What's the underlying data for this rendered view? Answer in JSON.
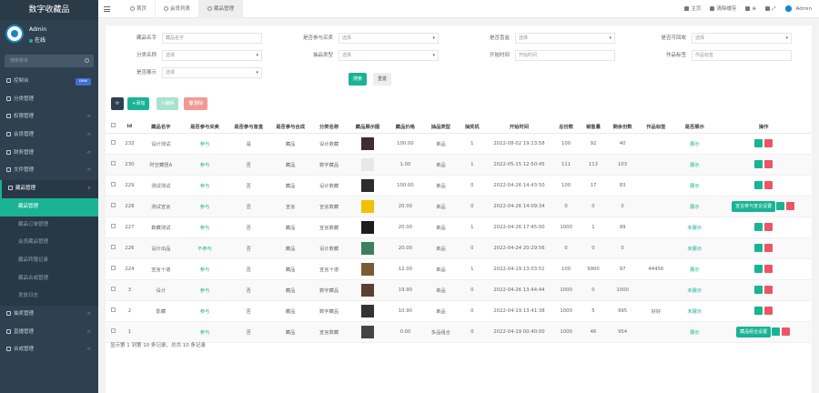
{
  "sidebar": {
    "brand": "数字收藏品",
    "user_name": "Admin",
    "user_status": "在线",
    "search_placeholder": "搜索菜单",
    "menu": [
      {
        "label": "控制台",
        "badge": "new"
      },
      {
        "label": "分类管理"
      },
      {
        "label": "权限管理",
        "chev": "<"
      },
      {
        "label": "会员管理",
        "chev": "<"
      },
      {
        "label": "财务管理",
        "chev": "<"
      },
      {
        "label": "文件管理",
        "chev": "<"
      },
      {
        "label": "藏品管理",
        "chev": "∨",
        "active": true
      }
    ],
    "submenu": [
      {
        "label": "藏品管理",
        "on": true
      },
      {
        "label": "藏品订单管理"
      },
      {
        "label": "会员藏品管理"
      },
      {
        "label": "藏品转赠记录"
      },
      {
        "label": "藏品合成管理"
      },
      {
        "label": "发放日志"
      }
    ],
    "menu2": [
      {
        "label": "抽奖管理",
        "chev": "<"
      },
      {
        "label": "直播管理",
        "chev": "<"
      },
      {
        "label": "合成管理",
        "chev": "<"
      }
    ]
  },
  "topbar": {
    "tabs": [
      "首页",
      "会员列表",
      "藏品管理"
    ],
    "right": [
      "主页",
      "清除缓存",
      "⊕",
      "⤢"
    ],
    "admin": "Admin"
  },
  "filters": {
    "row1": [
      {
        "label": "藏品名字",
        "placeholder": "藏品名字"
      },
      {
        "label": "是否参与买卖",
        "value": "选择",
        "select": true
      },
      {
        "label": "是否盲盒",
        "value": "选择",
        "select": true
      },
      {
        "label": "是否可回收",
        "value": "选择",
        "select": true
      }
    ],
    "row2": [
      {
        "label": "分类名称",
        "value": "选择",
        "select": true
      },
      {
        "label": "抽品类型",
        "value": "选择",
        "select": true
      },
      {
        "label": "开始时间",
        "placeholder": "开始时间"
      },
      {
        "label": "作品标签",
        "placeholder": "作品标签"
      }
    ],
    "row3": [
      {
        "label": "是否展示",
        "value": "选择",
        "select": true
      }
    ],
    "search": "搜索",
    "reset": "重置"
  },
  "toolbar": {
    "refresh": "⟳",
    "add": "+添加",
    "edit": "✎编辑",
    "delete": "🗑删除"
  },
  "table": {
    "headers": [
      "",
      "id",
      "藏品名字",
      "是否参与买卖",
      "是否参与盲盒",
      "是否参与合成",
      "分类名称",
      "藏品展示图",
      "藏品价格",
      "抽品类型",
      "抽奖机",
      "开始时间",
      "总份数",
      "销售量",
      "剩余份数",
      "作品标签",
      "是否展示",
      "操作"
    ],
    "rows": [
      {
        "id": "232",
        "name": "设计测试",
        "trade": "参与",
        "blind": "是",
        "merge": "藏品",
        "cat": "设计数藏",
        "price": "100.00",
        "type": "单品",
        "n": "1",
        "time": "2022-08-02 19:13:58",
        "total": "100",
        "sold": "92",
        "left": "40",
        "tag": "",
        "show": "展示",
        "extra": ""
      },
      {
        "id": "230",
        "name": "时空藏匣A",
        "trade": "参与",
        "blind": "否",
        "merge": "藏品",
        "cat": "数字藏品",
        "price": "1.00",
        "type": "单品",
        "n": "1",
        "time": "2022-05-15 12:50:45",
        "total": "111",
        "sold": "113",
        "left": "103",
        "tag": "",
        "show": "展示",
        "extra": ""
      },
      {
        "id": "229",
        "name": "测试测试",
        "trade": "参与",
        "blind": "否",
        "merge": "藏品",
        "cat": "设计数藏",
        "price": "100.00",
        "type": "单品",
        "n": "0",
        "time": "2022-04-26 14:43:50",
        "total": "100",
        "sold": "17",
        "left": "83",
        "tag": "",
        "show": "展示",
        "extra": ""
      },
      {
        "id": "228",
        "name": "测试宣言",
        "trade": "参与",
        "blind": "否",
        "merge": "宣言",
        "cat": "宣言数藏",
        "price": "20.00",
        "type": "单品",
        "n": "0",
        "time": "2022-04-26 14:09:34",
        "total": "0",
        "sold": "0",
        "left": "0",
        "tag": "",
        "show": "展示",
        "extra": "宣言参与宣言设置"
      },
      {
        "id": "227",
        "name": "数藏测试",
        "trade": "参与",
        "blind": "否",
        "merge": "藏品",
        "cat": "宣言数藏",
        "price": "20.00",
        "type": "单品",
        "n": "1",
        "time": "2022-04-26 17:45:00",
        "total": "1000",
        "sold": "1",
        "left": "99",
        "tag": "",
        "show": "未展示",
        "extra": ""
      },
      {
        "id": "226",
        "name": "设计出品",
        "trade": "不参与",
        "blind": "否",
        "merge": "藏品",
        "cat": "设计数藏",
        "price": "20.00",
        "type": "单品",
        "n": "0",
        "time": "2022-04-24 20:29:56",
        "total": "0",
        "sold": "0",
        "left": "0",
        "tag": "",
        "show": "未展示",
        "extra": ""
      },
      {
        "id": "224",
        "name": "宣言十道",
        "trade": "参与",
        "blind": "否",
        "merge": "藏品",
        "cat": "宣言十道",
        "price": "12.00",
        "type": "单品",
        "n": "1",
        "time": "2022-04-19 13:03:51",
        "total": "100",
        "sold": "9900",
        "left": "97",
        "tag": "44456",
        "show": "展示",
        "extra": ""
      },
      {
        "id": "3",
        "name": "设计",
        "trade": "参与",
        "blind": "否",
        "merge": "藏品",
        "cat": "数字藏品",
        "price": "19.90",
        "type": "单品",
        "n": "0",
        "time": "2022-04-26 13:44:44",
        "total": "1000",
        "sold": "0",
        "left": "1000",
        "tag": "",
        "show": "未展示",
        "extra": ""
      },
      {
        "id": "2",
        "name": "影藏",
        "trade": "参与",
        "blind": "否",
        "merge": "藏品",
        "cat": "数字藏品",
        "price": "10.90",
        "type": "单品",
        "n": "0",
        "time": "2022-04-19 13:41:38",
        "total": "1000",
        "sold": "5",
        "left": "995",
        "tag": "好好",
        "show": "未展示",
        "extra": ""
      },
      {
        "id": "1",
        "name": "",
        "trade": "参与",
        "blind": "否",
        "merge": "藏品",
        "cat": "宣言数藏",
        "price": "0.00",
        "type": "多品组合",
        "n": "0",
        "time": "2022-04-19 00:40:00",
        "total": "1000",
        "sold": "46",
        "left": "954",
        "tag": "",
        "show": "展示",
        "extra": "藏品组合设置"
      }
    ]
  },
  "footer": "显示第 1 到第 10 条记录，总共 10 条记录",
  "colors": {
    "accent": "#1ab394",
    "danger": "#ed5565",
    "sidebar": "#2f4050"
  }
}
